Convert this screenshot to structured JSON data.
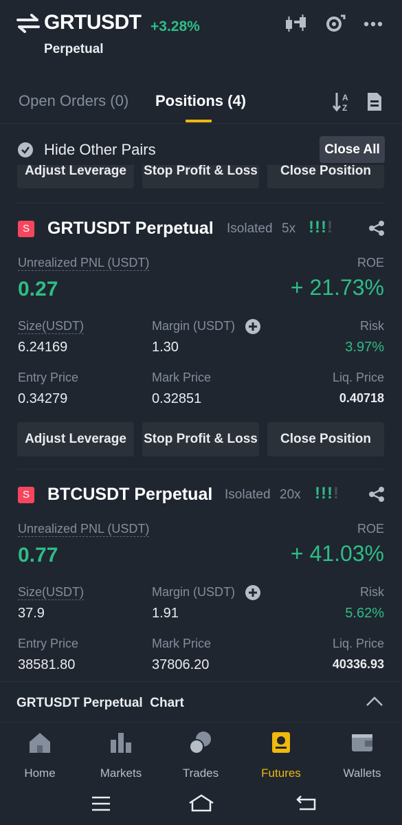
{
  "header": {
    "pair": "GRTUSDT",
    "change": "+3.28%",
    "subtitle": "Perpetual"
  },
  "tabs": {
    "open_orders": "Open Orders (0)",
    "positions": "Positions (4)"
  },
  "filter": {
    "hide_other_pairs": "Hide Other Pairs",
    "close_all": "Close All"
  },
  "actions": {
    "adjust_leverage": "Adjust Leverage",
    "stop_profit_loss": "Stop Profit & Loss",
    "close_position": "Close Position"
  },
  "labels": {
    "unrealized_pnl": "Unrealized PNL (USDT)",
    "roe": "ROE",
    "size": "Size(USDT)",
    "margin": "Margin (USDT)",
    "risk": "Risk",
    "entry_price": "Entry Price",
    "mark_price": "Mark Price",
    "liq_price": "Liq. Price"
  },
  "positions": [
    {
      "side": "S",
      "title": "GRTUSDT Perpetual",
      "margin_mode": "Isolated",
      "leverage": "5x",
      "pnl": "0.27",
      "roe": "+ 21.73%",
      "size": "6.24169",
      "margin": "1.30",
      "risk": "3.97%",
      "entry_price": "0.34279",
      "mark_price": "0.32851",
      "liq_price": "0.40718"
    },
    {
      "side": "S",
      "title": "BTCUSDT Perpetual",
      "margin_mode": "Isolated",
      "leverage": "20x",
      "pnl": "0.77",
      "roe": "+ 41.03%",
      "size": "37.9",
      "margin": "1.91",
      "risk": "5.62%",
      "entry_price": "38581.80",
      "mark_price": "37806.20",
      "liq_price": "40336.93"
    }
  ],
  "chart_bar": {
    "label": "GRTUSDT Perpetual  Chart"
  },
  "nav": [
    {
      "label": "Home",
      "icon": "home-icon"
    },
    {
      "label": "Markets",
      "icon": "markets-icon"
    },
    {
      "label": "Trades",
      "icon": "trades-icon"
    },
    {
      "label": "Futures",
      "icon": "futures-icon"
    },
    {
      "label": "Wallets",
      "icon": "wallets-icon"
    }
  ],
  "colors": {
    "background": "#1f2630",
    "green": "#2ebd85",
    "red": "#f6465d",
    "accent": "#f0b90b"
  }
}
